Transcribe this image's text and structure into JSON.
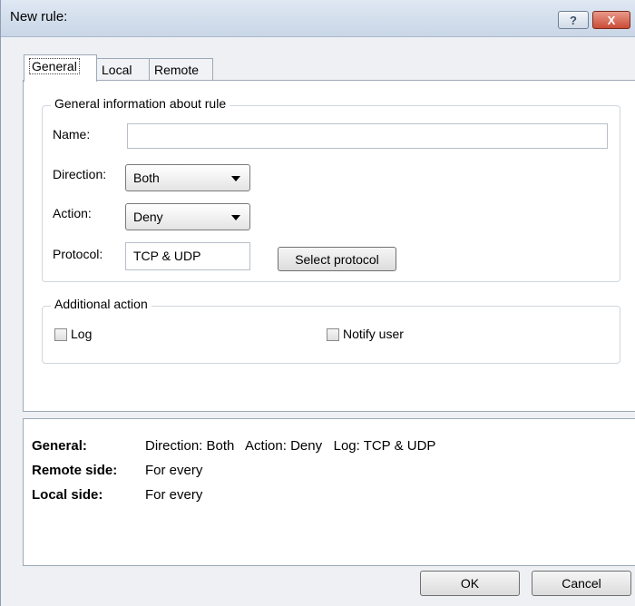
{
  "window": {
    "title": "New rule:",
    "help_glyph": "?",
    "close_glyph": "X"
  },
  "tabs": [
    {
      "label": "General",
      "active": true
    },
    {
      "label": "Local",
      "active": false
    },
    {
      "label": "Remote",
      "active": false
    }
  ],
  "general_group": {
    "legend": "General information about rule",
    "name_label": "Name:",
    "name_value": "",
    "direction_label": "Direction:",
    "direction_value": "Both",
    "action_label": "Action:",
    "action_value": "Deny",
    "protocol_label": "Protocol:",
    "protocol_value": "TCP & UDP",
    "select_protocol_button": "Select protocol"
  },
  "additional_group": {
    "legend": "Additional action",
    "log_label": "Log",
    "log_checked": false,
    "notify_label": "Notify user",
    "notify_checked": false
  },
  "summary": {
    "general_key": "General:",
    "general_value": "Direction: Both   Action: Deny   Log: TCP & UDP",
    "remote_key": "Remote side:",
    "remote_value": "For every",
    "local_key": "Local side:",
    "local_value": "For every"
  },
  "footer": {
    "ok_label": "OK",
    "cancel_label": "Cancel"
  }
}
